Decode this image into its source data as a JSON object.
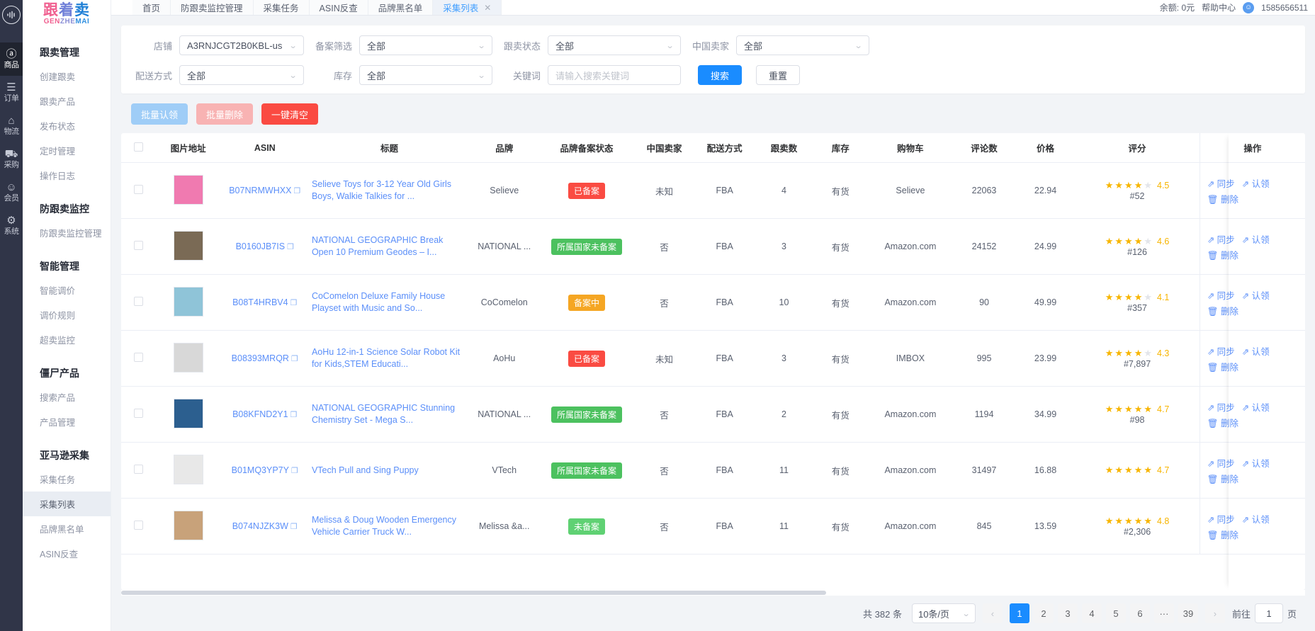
{
  "rail": {
    "logo_icon": "waveform-logo-icon",
    "items": [
      {
        "icon": "amazon-box-icon",
        "glyph": "ⓐ",
        "label": "商品",
        "active": true
      },
      {
        "icon": "order-doc-icon",
        "glyph": "☰",
        "label": "订单",
        "active": false
      },
      {
        "icon": "logistics-home-icon",
        "glyph": "⌂",
        "label": "物流",
        "active": false
      },
      {
        "icon": "purchase-cart-icon",
        "glyph": "⛟",
        "label": "采购",
        "active": false
      },
      {
        "icon": "member-user-icon",
        "glyph": "☺",
        "label": "会员",
        "active": false
      },
      {
        "icon": "system-gear-icon",
        "glyph": "⚙",
        "label": "系统",
        "active": false
      }
    ]
  },
  "brand": {
    "cn1": "跟",
    "cn2": "着",
    "cn3": "卖",
    "en1": "GEN",
    "en2": "ZHE",
    "en3": "MAI"
  },
  "sidebar": {
    "groups": [
      {
        "title": "跟卖管理",
        "items": [
          {
            "label": "创建跟卖",
            "active": false
          },
          {
            "label": "跟卖产品",
            "active": false
          },
          {
            "label": "发布状态",
            "active": false
          },
          {
            "label": "定时管理",
            "active": false
          },
          {
            "label": "操作日志",
            "active": false
          }
        ]
      },
      {
        "title": "防跟卖监控",
        "items": [
          {
            "label": "防跟卖监控管理",
            "active": false
          }
        ]
      },
      {
        "title": "智能管理",
        "items": [
          {
            "label": "智能调价",
            "active": false
          },
          {
            "label": "调价规则",
            "active": false
          },
          {
            "label": "超卖监控",
            "active": false
          }
        ]
      },
      {
        "title": "僵尸产品",
        "items": [
          {
            "label": "搜索产品",
            "active": false
          },
          {
            "label": "产品管理",
            "active": false
          }
        ]
      },
      {
        "title": "亚马逊采集",
        "items": [
          {
            "label": "采集任务",
            "active": false
          },
          {
            "label": "采集列表",
            "active": true
          },
          {
            "label": "品牌黑名单",
            "active": false
          },
          {
            "label": "ASIN反查",
            "active": false
          }
        ]
      }
    ]
  },
  "topbar": {
    "tabs": [
      {
        "label": "首页",
        "active": false,
        "closable": false
      },
      {
        "label": "防跟卖监控管理",
        "active": false,
        "closable": false
      },
      {
        "label": "采集任务",
        "active": false,
        "closable": false
      },
      {
        "label": "ASIN反查",
        "active": false,
        "closable": false
      },
      {
        "label": "品牌黑名单",
        "active": false,
        "closable": false
      },
      {
        "label": "采集列表",
        "active": true,
        "closable": true
      }
    ],
    "close_glyph": "✕",
    "balance": "余额: 0元",
    "help": "帮助中心",
    "avatar_glyph": "☺",
    "account": "1585656511"
  },
  "filters": {
    "store": {
      "label": "店铺",
      "value": "A3RNJCGT2B0KBL-us"
    },
    "record_filter": {
      "label": "备案筛选",
      "value": "全部"
    },
    "follow_status": {
      "label": "跟卖状态",
      "value": "全部"
    },
    "china_seller": {
      "label": "中国卖家",
      "value": "全部"
    },
    "ship_method": {
      "label": "配送方式",
      "value": "全部"
    },
    "stock": {
      "label": "库存",
      "value": "全部"
    },
    "keyword": {
      "label": "关键词",
      "placeholder": "请输入搜索关键词",
      "value": ""
    },
    "search_button": "搜索",
    "reset_button": "重置",
    "caret_glyph": "⌄"
  },
  "bulk_actions": {
    "claim": "批量认领",
    "delete": "批量删除",
    "clear_all": "一键清空"
  },
  "table": {
    "columns": [
      "图片地址",
      "ASIN",
      "标题",
      "品牌",
      "品牌备案状态",
      "中国卖家",
      "配送方式",
      "跟卖数",
      "库存",
      "购物车",
      "评论数",
      "价格",
      "评分",
      "操作"
    ],
    "copy_glyph": "❐",
    "star_full": "★",
    "ops_sync": "同步",
    "ops_claim": "认领",
    "ops_delete": "删除",
    "ops_sync_icon": "⇗",
    "ops_claim_icon": "⇗",
    "ops_delete_icon": "🗑",
    "rows": [
      {
        "asin": "B07NRMWHXX",
        "title": "Selieve Toys for 3-12 Year Old Girls Boys, Walkie Talkies for ...",
        "brand": "Selieve",
        "record_status": "已备案",
        "record_color": "red",
        "china_seller": "未知",
        "ship": "FBA",
        "follow_count": "4",
        "stock": "有货",
        "cart": "Selieve",
        "reviews": "22063",
        "price": "22.94",
        "stars": 4.5,
        "score": "4.5",
        "rank": "#52",
        "thumb_color": "#f07ab0"
      },
      {
        "asin": "B0160JB7IS",
        "title": "NATIONAL GEOGRAPHIC Break Open 10 Premium Geodes – I...",
        "brand": "NATIONAL ...",
        "record_status": "所属国家未备案",
        "record_color": "green",
        "china_seller": "否",
        "ship": "FBA",
        "follow_count": "3",
        "stock": "有货",
        "cart": "Amazon.com",
        "reviews": "24152",
        "price": "24.99",
        "stars": 4.5,
        "score": "4.6",
        "rank": "#126",
        "thumb_color": "#7a6a55"
      },
      {
        "asin": "B08T4HRBV4",
        "title": "CoComelon Deluxe Family House Playset with Music and So...",
        "brand": "CoComelon",
        "record_status": "备案中",
        "record_color": "orange",
        "china_seller": "否",
        "ship": "FBA",
        "follow_count": "10",
        "stock": "有货",
        "cart": "Amazon.com",
        "reviews": "90",
        "price": "49.99",
        "stars": 4,
        "score": "4.1",
        "rank": "#357",
        "thumb_color": "#8fc4d8"
      },
      {
        "asin": "B08393MRQR",
        "title": "AoHu 12-in-1 Science Solar Robot Kit for Kids,STEM Educati...",
        "brand": "AoHu",
        "record_status": "已备案",
        "record_color": "red",
        "china_seller": "未知",
        "ship": "FBA",
        "follow_count": "3",
        "stock": "有货",
        "cart": "IMBOX",
        "reviews": "995",
        "price": "23.99",
        "stars": 4.5,
        "score": "4.3",
        "rank": "#7,897",
        "thumb_color": "#d8d8d8"
      },
      {
        "asin": "B08KFND2Y1",
        "title": "NATIONAL GEOGRAPHIC Stunning Chemistry Set - Mega S...",
        "brand": "NATIONAL ...",
        "record_status": "所属国家未备案",
        "record_color": "green",
        "china_seller": "否",
        "ship": "FBA",
        "follow_count": "2",
        "stock": "有货",
        "cart": "Amazon.com",
        "reviews": "1194",
        "price": "34.99",
        "stars": 5,
        "score": "4.7",
        "rank": "#98",
        "thumb_color": "#2c5f8f"
      },
      {
        "asin": "B01MQ3YP7Y",
        "title": "VTech Pull and Sing Puppy",
        "brand": "VTech",
        "record_status": "所属国家未备案",
        "record_color": "green",
        "china_seller": "否",
        "ship": "FBA",
        "follow_count": "11",
        "stock": "有货",
        "cart": "Amazon.com",
        "reviews": "31497",
        "price": "16.88",
        "stars": 5,
        "score": "4.7",
        "rank": "",
        "thumb_color": "#e8e8e8"
      },
      {
        "asin": "B074NJZK3W",
        "title": "Melissa & Doug Wooden Emergency Vehicle Carrier Truck W...",
        "brand": "Melissa &a...",
        "record_status": "未备案",
        "record_color": "lgreen",
        "china_seller": "否",
        "ship": "FBA",
        "follow_count": "11",
        "stock": "有货",
        "cart": "Amazon.com",
        "reviews": "845",
        "price": "13.59",
        "stars": 5,
        "score": "4.8",
        "rank": "#2,306",
        "thumb_color": "#c8a27a"
      }
    ]
  },
  "footer": {
    "total": "共 382 条",
    "page_size": "10条/页",
    "prev_glyph": "‹",
    "next_glyph": "›",
    "pages": [
      "1",
      "2",
      "3",
      "4",
      "5",
      "6",
      "···",
      "39"
    ],
    "current_page": "1",
    "goto_label": "前往",
    "goto_value": "1",
    "goto_unit": "页"
  }
}
